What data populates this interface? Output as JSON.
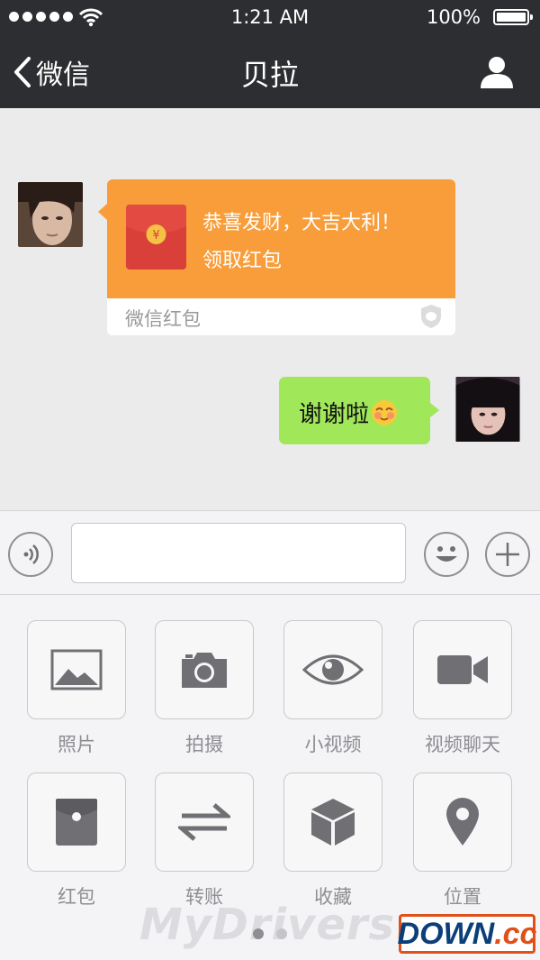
{
  "status_bar": {
    "time": "1:21 AM",
    "battery": "100%"
  },
  "nav": {
    "back_label": "微信",
    "title": "贝拉"
  },
  "messages": {
    "red_packet": {
      "greeting": "恭喜发财，大吉大利！",
      "action": "领取红包",
      "source": "微信红包"
    },
    "outgoing_text": "谢谢啦"
  },
  "input": {
    "placeholder": ""
  },
  "panel": {
    "items": [
      {
        "label": "照片",
        "icon": "photo-icon"
      },
      {
        "label": "拍摄",
        "icon": "camera-icon"
      },
      {
        "label": "小视频",
        "icon": "eye-icon"
      },
      {
        "label": "视频聊天",
        "icon": "video-camera-icon"
      },
      {
        "label": "红包",
        "icon": "red-packet-icon"
      },
      {
        "label": "转账",
        "icon": "transfer-icon"
      },
      {
        "label": "收藏",
        "icon": "cube-icon"
      },
      {
        "label": "位置",
        "icon": "location-pin-icon"
      }
    ],
    "page_count": 2,
    "active_page": 1
  },
  "watermark": {
    "text": "MyDrivers.com",
    "logo_main": "DOWN",
    "logo_suffix": ".cc"
  },
  "colors": {
    "bar": "#2d2e31",
    "red_packet": "#f89d3a",
    "outgoing_bubble": "#a0e75a",
    "icon_gray": "#707074"
  }
}
